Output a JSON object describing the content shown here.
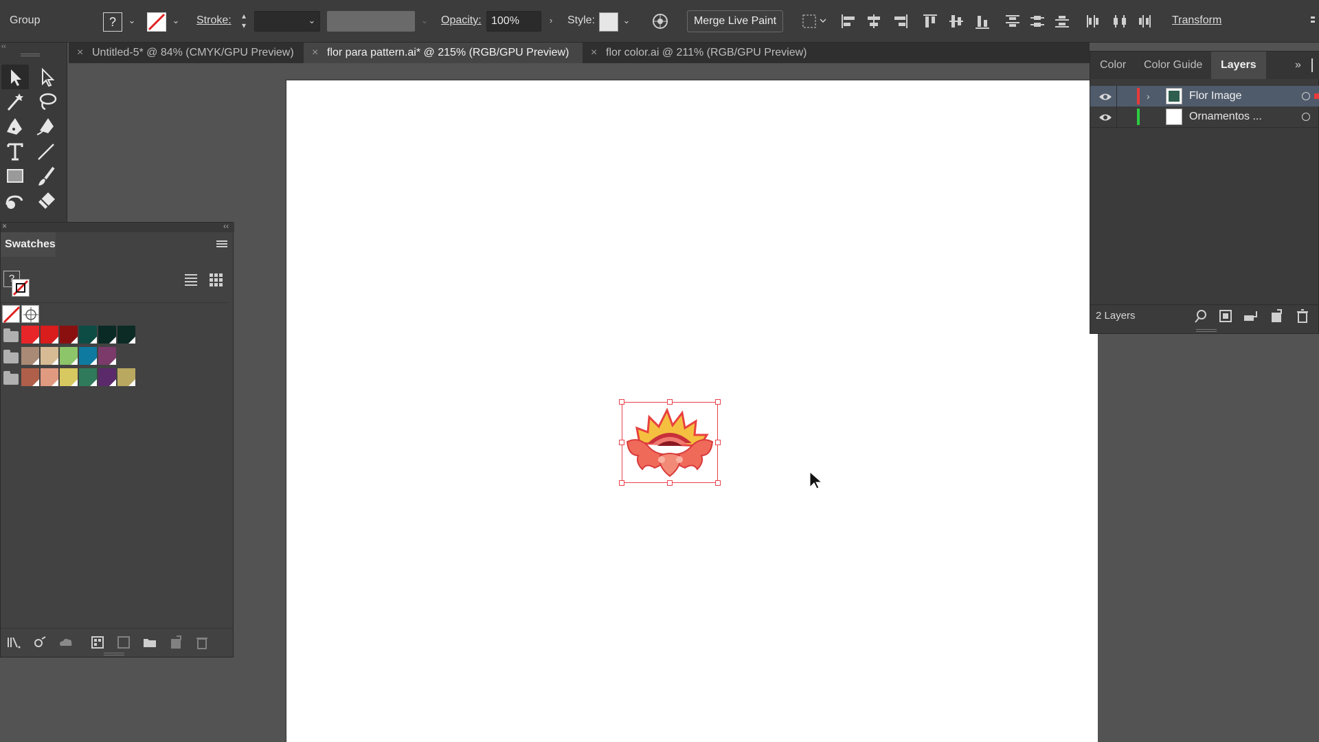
{
  "control_bar": {
    "selection_type": "Group",
    "fill_indicator": "?",
    "stroke_label": "Stroke:",
    "opacity_label": "Opacity:",
    "opacity_value": "100%",
    "style_label": "Style:",
    "merge_live_paint_label": "Merge Live Paint",
    "transform_label": "Transform"
  },
  "tabs": [
    {
      "close": "×",
      "label": "Untitled-5* @ 84% (CMYK/GPU Preview)",
      "active": false
    },
    {
      "close": "×",
      "label": "flor para pattern.ai* @ 215% (RGB/GPU Preview)",
      "active": true
    },
    {
      "close": "×",
      "label": "flor color.ai @ 211% (RGB/GPU Preview)",
      "active": false
    }
  ],
  "swatches_panel": {
    "title": "Swatches",
    "fill_indicator": "?",
    "groups": [
      {
        "icon": "folder-icon",
        "colors": [
          "#e8262a",
          "#d91c1c",
          "#8a1010",
          "#0c4c45",
          "#0a2a25",
          "#0c2b24"
        ]
      },
      {
        "icon": "folder-icon",
        "colors": [
          "#a88a76",
          "#d6bb95",
          "#8dc56a",
          "#0f7aa0",
          "#7c3a6a"
        ]
      },
      {
        "icon": "folder-icon",
        "colors": [
          "#b0604a",
          "#e09a80",
          "#d8c860",
          "#2f7a5a",
          "#5a2a6a",
          "#b8a860"
        ]
      }
    ]
  },
  "layers_panel": {
    "tabs": [
      "Color",
      "Color Guide",
      "Layers"
    ],
    "active_tab": "Layers",
    "layers": [
      {
        "name": "Flor Image",
        "color": "#e83a3a",
        "selected": true
      },
      {
        "name": "Ornamentos ...",
        "color": "#2ecc40",
        "selected": false
      }
    ],
    "footer_label": "2 Layers"
  },
  "colors": {
    "selection": "#e8404a",
    "flower_outer": "#f05a4a",
    "flower_petal": "#f5c040"
  }
}
